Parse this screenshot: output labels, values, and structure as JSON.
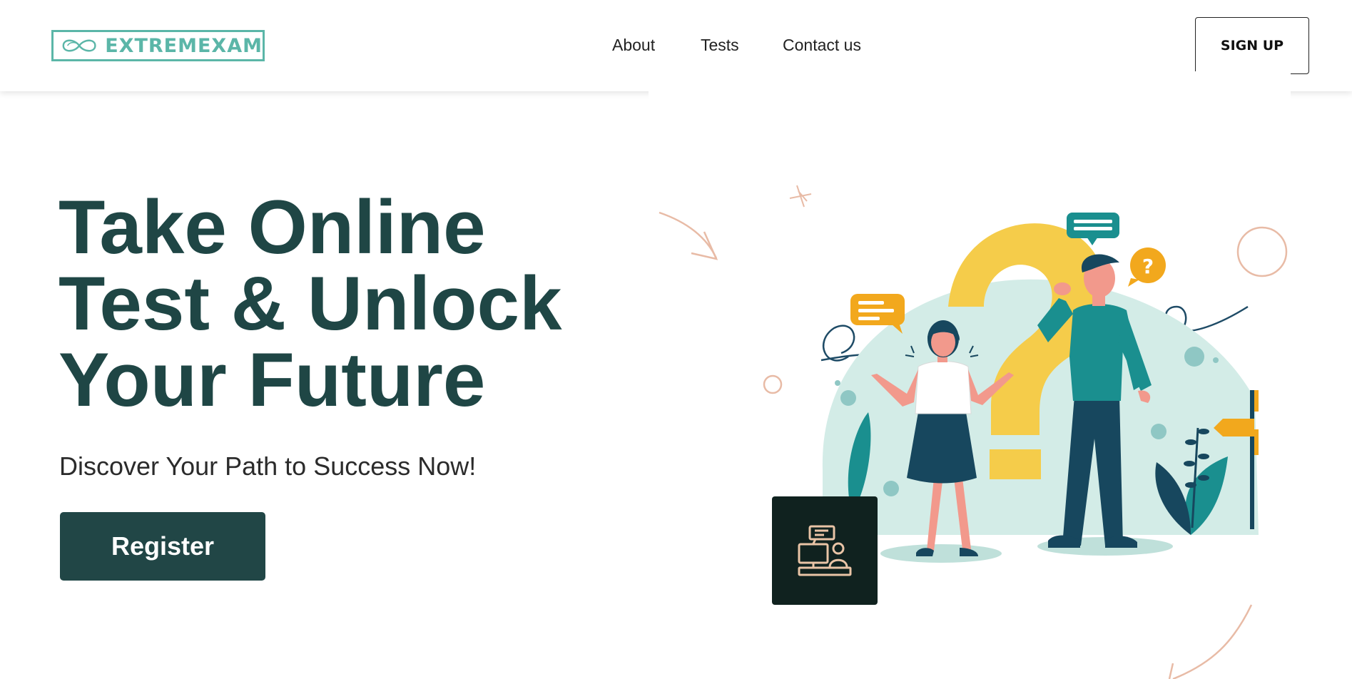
{
  "brand": {
    "name": "EXTREMEXAM",
    "accent": "#5bb6a8"
  },
  "nav": {
    "items": [
      "About",
      "Tests",
      "Contact us"
    ]
  },
  "header": {
    "signup_label": "SIGN UP"
  },
  "hero": {
    "title_lines": [
      "Take Online",
      "Test & Unlock",
      "Your Future"
    ],
    "subtitle": "Discover Your Path to Success Now!",
    "register_label": "Register",
    "title_color": "#1f4645",
    "button_color": "#214646"
  },
  "illustration": {
    "icons": [
      "infinity-logo-icon",
      "chat-bubble-icon",
      "question-bubble-icon",
      "computer-user-icon",
      "signpost-icon"
    ]
  }
}
